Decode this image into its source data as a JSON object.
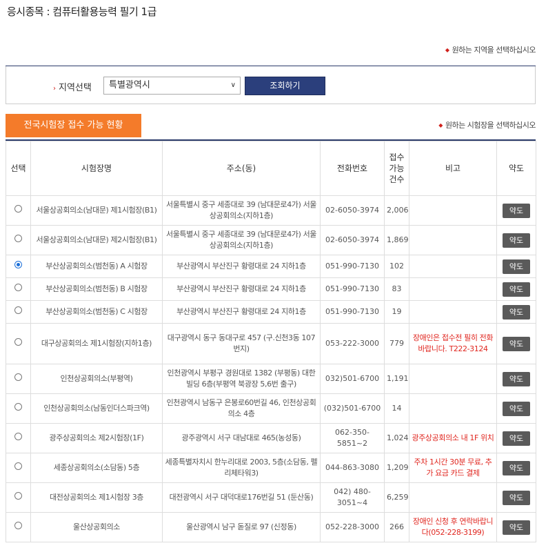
{
  "header": {
    "title": "응시종목 : 컴퓨터활용능력 필기 1급"
  },
  "hints": {
    "region_hint": "원하는 지역을 선택하십시오",
    "site_hint": "원하는 시험장을 선택하십시오"
  },
  "region": {
    "label": "지역선택",
    "selected": "특별광역시",
    "search_button": "조회하기"
  },
  "tab": {
    "label": "전국시험장 접수 가능 현황"
  },
  "table": {
    "headers": {
      "select": "선택",
      "site": "시험장명",
      "address": "주소(동)",
      "phone": "전화번호",
      "count": "접수가능건수",
      "note": "비고",
      "map": "약도"
    },
    "map_label": "약도",
    "rows": [
      {
        "checked": false,
        "site": "서울상공회의소(남대문) 제1시험장(B1)",
        "address": "서울특별시 중구 세종대로 39 (남대문로4가) 서울상공회의소(지하1층)",
        "phone": "02-6050-3974",
        "count": "2,006",
        "note": ""
      },
      {
        "checked": false,
        "site": "서울상공회의소(남대문) 제2시험장(B1)",
        "address": "서울특별시 중구 세종대로 39 (남대문로4가) 서울상공회의소(지하1층)",
        "phone": "02-6050-3974",
        "count": "1,869",
        "note": ""
      },
      {
        "checked": true,
        "site": "부산상공회의소(범천동) A 시험장",
        "address": "부산광역시 부산진구 황령대로 24 지하1층",
        "phone": "051-990-7130",
        "count": "102",
        "note": ""
      },
      {
        "checked": false,
        "site": "부산상공회의소(범천동) B 시험장",
        "address": "부산광역시 부산진구 황령대로 24 지하1층",
        "phone": "051-990-7130",
        "count": "83",
        "note": ""
      },
      {
        "checked": false,
        "site": "부산상공회의소(범천동) C 시험장",
        "address": "부산광역시 부산진구 황령대로 24 지하1층",
        "phone": "051-990-7130",
        "count": "19",
        "note": ""
      },
      {
        "checked": false,
        "site": "대구상공회의소 제1시험장(지하1층)",
        "address": "대구광역시 동구 동대구로 457 (구.신천3동 107번지)",
        "phone": "053-222-3000",
        "count": "779",
        "note": "장애인은 접수전 필히 전화바랍니다. T222-3124"
      },
      {
        "checked": false,
        "site": "인천상공회의소(부평역)",
        "address": "인천광역시 부평구 경원대로 1382 (부평동) 대한빌딩 6층(부평역 북광장 5,6번 출구)",
        "phone": "032)501-6700",
        "count": "1,191",
        "note": ""
      },
      {
        "checked": false,
        "site": "인천상공회의소(남동인더스파크역)",
        "address": "인천광역시 남동구 은봉로60번길 46, 인천상공회의소 4층",
        "phone": "(032)501-6700",
        "count": "14",
        "note": ""
      },
      {
        "checked": false,
        "site": "광주상공회의소 제2시험장(1F)",
        "address": "광주광역시 서구 대남대로 465(농성동)",
        "phone": "062-350-5851~2",
        "count": "1,024",
        "note": "광주상공회의소 내 1F 위치"
      },
      {
        "checked": false,
        "site": "세종상공회의소(소담동) 5층",
        "address": "세종특별자치시 한누리대로 2003, 5층(소담동, 펠리체타워3)",
        "phone": "044-863-3080",
        "count": "1,209",
        "note": "주차 1시간 30분 무료, 추가 요금 카드 결제"
      },
      {
        "checked": false,
        "site": "대전상공회의소 제1시험장 3층",
        "address": "대전광역시 서구 대덕대로176번길 51 (둔산동)",
        "phone": "042) 480-3051~4",
        "count": "6,259",
        "note": ""
      },
      {
        "checked": false,
        "site": "울산상공회의소",
        "address": "울산광역시 남구 돋질로 97 (신정동)",
        "phone": "052-228-3000",
        "count": "266",
        "note": "장애인 신청 후 연락바랍니다(052-228-3199)"
      }
    ]
  }
}
